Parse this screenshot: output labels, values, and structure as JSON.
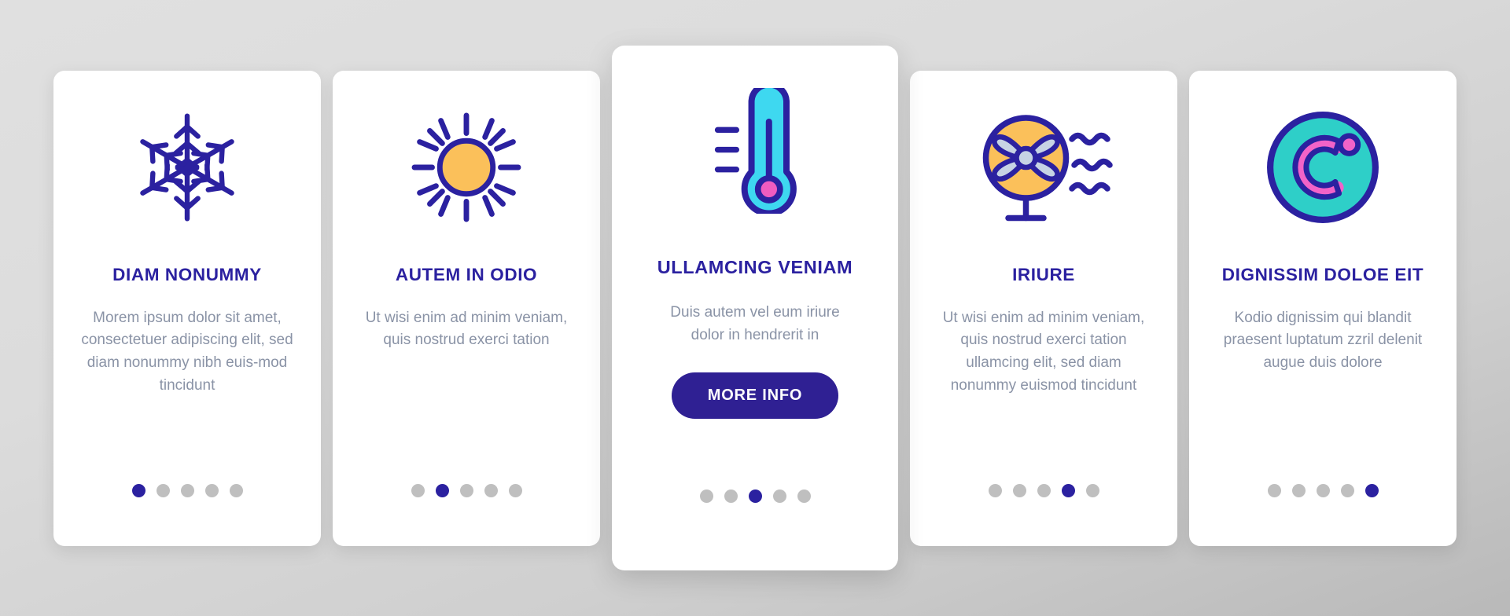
{
  "background": {
    "top_color": "#e0e0e0",
    "bottom_color": "#b9b9b9"
  },
  "theme": {
    "primary": "#2b21a0",
    "button": "#2f2093",
    "body_text": "#8a93a6",
    "dot_inactive": "#bfbfbf",
    "card_bg": "#ffffff",
    "sun_yellow": "#fbc05a",
    "thermo_cyan": "#3ed8f0",
    "thermo_pink": "#ef5cc0",
    "fan_blade": "#c6d3e4",
    "celsius_teal": "#2ecfc8",
    "celsius_pink": "#f263c8"
  },
  "cards": [
    {
      "icon": "snowflake-icon",
      "title": "DIAM NONUMMY",
      "description": "Morem ipsum dolor sit amet, consectetuer adipiscing elit, sed diam nonummy nibh euis-mod tincidunt",
      "button_label": null,
      "dots": {
        "count": 5,
        "active_index": 0
      }
    },
    {
      "icon": "sun-icon",
      "title": "AUTEM IN ODIO",
      "description": "Ut wisi enim ad minim veniam, quis nostrud exerci tation",
      "button_label": null,
      "dots": {
        "count": 5,
        "active_index": 1
      }
    },
    {
      "icon": "thermometer-icon",
      "title": "ULLAMCING VENIAM",
      "description": "Duis autem vel eum iriure dolor in hendrerit in",
      "button_label": "MORE INFO",
      "dots": {
        "count": 5,
        "active_index": 2
      }
    },
    {
      "icon": "fan-icon",
      "title": "IRIURE",
      "description": "Ut wisi enim ad minim veniam, quis nostrud exerci tation ullamcing elit, sed diam nonummy euismod tincidunt",
      "button_label": null,
      "dots": {
        "count": 5,
        "active_index": 3
      }
    },
    {
      "icon": "celsius-degree-icon",
      "title": "DIGNISSIM DOLOE EIT",
      "description": "Kodio dignissim qui blandit praesent luptatum zzril delenit augue duis dolore",
      "button_label": null,
      "dots": {
        "count": 5,
        "active_index": 4
      }
    }
  ]
}
